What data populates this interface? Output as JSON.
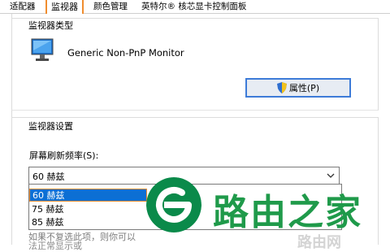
{
  "tabs": [
    {
      "label": "适配器"
    },
    {
      "label": "监视器"
    },
    {
      "label": "颜色管理"
    },
    {
      "label": "英特尔® 核芯显卡控制面板"
    }
  ],
  "monitor_type": {
    "legend": "监视器类型",
    "name": "Generic Non-PnP Monitor",
    "properties_button": "属性(P)"
  },
  "monitor_settings": {
    "legend": "监视器设置",
    "refresh_label": "屏幕刷新频率(S):",
    "selected_value": "60 赫兹",
    "options": [
      "60 赫兹",
      "75 赫兹",
      "85 赫兹"
    ],
    "hint_line1": "如果不复选此项，则你可以",
    "hint_line2": "法正常显示或"
  },
  "watermark": {
    "text": "路由之家",
    "faint": "路由网"
  },
  "colors": {
    "highlight": "#0c6fd4",
    "tab_border": "#f08d2f",
    "watermark": "#1f9a4a"
  }
}
